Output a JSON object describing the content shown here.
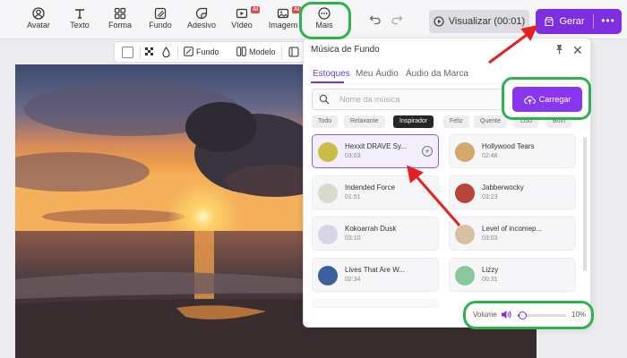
{
  "toolbar": {
    "items": [
      {
        "label": "Avatar",
        "icon": "avatar-icon"
      },
      {
        "label": "Texto",
        "icon": "text-icon"
      },
      {
        "label": "Forma",
        "icon": "shapes-icon"
      },
      {
        "label": "Fundo",
        "icon": "background-icon"
      },
      {
        "label": "Adesivo",
        "icon": "sticker-icon"
      },
      {
        "label": "Vídeo",
        "icon": "video-icon",
        "badge": "AI"
      },
      {
        "label": "Imagem",
        "icon": "image-icon",
        "badge": "AI"
      },
      {
        "label": "Mais",
        "icon": "more-icon"
      }
    ],
    "preview_label": "Visualizar (00:01)",
    "generate_label": "Gerar",
    "more_label": "•••"
  },
  "subbar": {
    "fundo_label": "Fundo",
    "modelo_label": "Modelo"
  },
  "panel": {
    "title": "Música de Fundo",
    "tabs": [
      "Estoques",
      "Meu Áudio",
      "Áudio da Marca"
    ],
    "active_tab": "Estoques",
    "search_placeholder": "Nome da música",
    "upload_label": "Carregar",
    "filters": [
      "Todo",
      "Relaxante",
      "Inspirador",
      "Feliz",
      "Quente",
      "Liso",
      "Brilh"
    ],
    "selected_filter": "Inspirador",
    "tracks": [
      {
        "title": "Hexxit DRAVE Sy...",
        "duration": "03:03",
        "color": "#c8bd45"
      },
      {
        "title": "Hollywood Tears",
        "duration": "02:46",
        "color": "#d4a86a"
      },
      {
        "title": "Indended Force",
        "duration": "01:51",
        "color": "#d8dcc8"
      },
      {
        "title": "Jabberwocky",
        "duration": "03:23",
        "color": "#b8453a"
      },
      {
        "title": "Kokoarrah Dusk",
        "duration": "03:10",
        "color": "#d9d5e8"
      },
      {
        "title": "Level of incomep...",
        "duration": "03:03",
        "color": "#d8c0a0"
      },
      {
        "title": "Lives That Are W...",
        "duration": "02:34",
        "color": "#3d5f9e"
      },
      {
        "title": "Lizzy",
        "duration": "00:31",
        "color": "#88c89a"
      }
    ],
    "volume_label": "Volume",
    "volume_value": "10%",
    "volume_level": 0.1
  },
  "colors": {
    "accent": "#7b2fe0",
    "highlight": "#2db34a",
    "arrow": "#e52222"
  }
}
